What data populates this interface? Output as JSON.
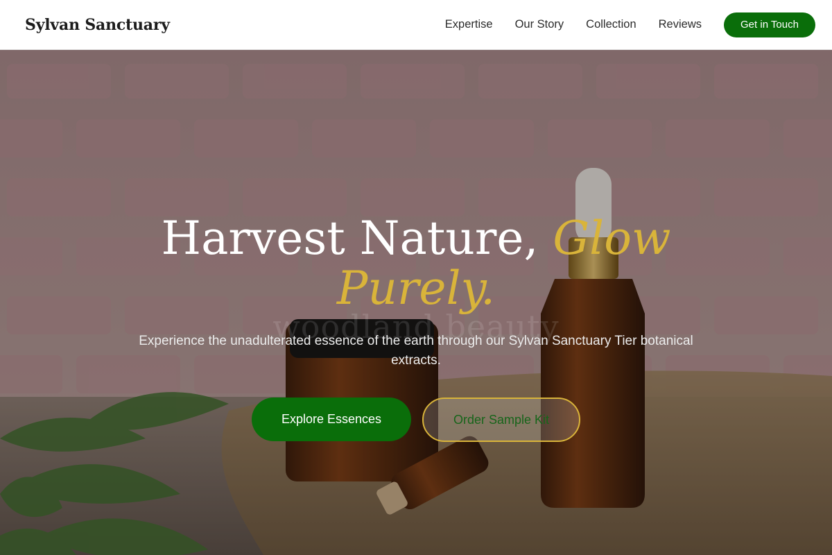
{
  "header": {
    "brand": "Sylvan Sanctuary",
    "nav": [
      "Expertise",
      "Our Story",
      "Collection",
      "Reviews"
    ],
    "cta_label": "Get in Touch"
  },
  "hero": {
    "title_main": "Harvest Nature, ",
    "title_accent": "Glow Purely.",
    "watermark": "woodland beauty",
    "subtitle": "Experience the unadulterated essence of the earth through our Sylvan Sanctuary Tier botanical extracts.",
    "primary_label": "Explore Essences",
    "secondary_label": "Order Sample Kit"
  },
  "colors": {
    "brand_green": "#0a6e0a",
    "accent_gold": "#d9b43a",
    "header_bg": "#ffffff"
  }
}
